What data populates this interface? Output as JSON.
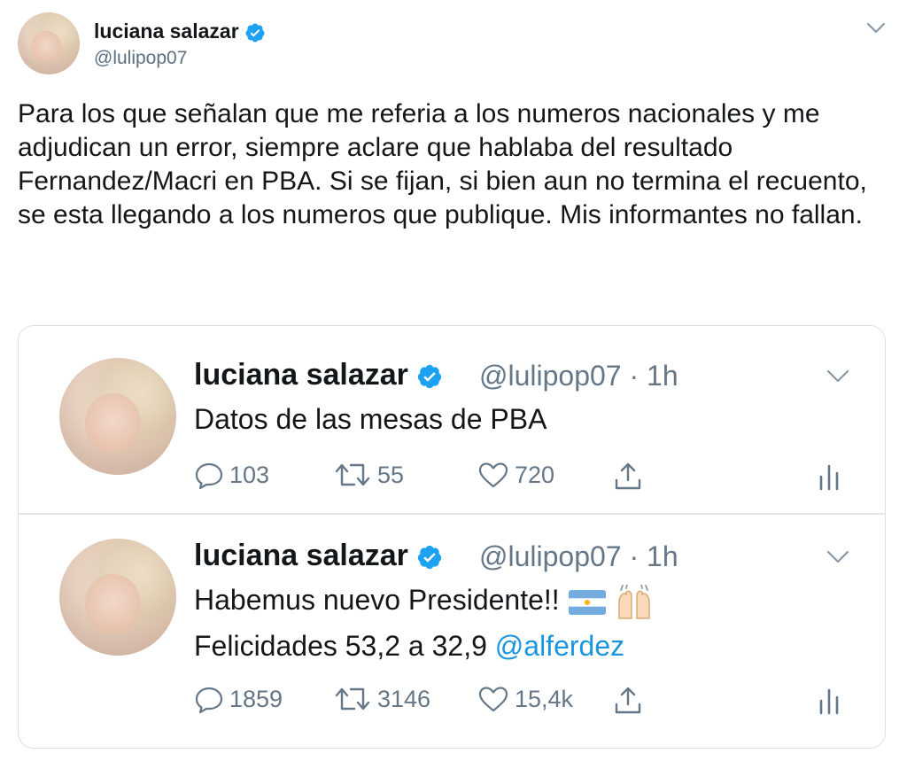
{
  "main_tweet": {
    "author_name": "luciana salazar",
    "author_handle": "@lulipop07",
    "text": "Para los que señalan que me referia a los numeros nacionales y me adjudican un error, siempre aclare que hablaba del resultado Fernandez/Macri en PBA. Si se fijan, si bien aun no termina el recuento, se esta llegando a los numeros que publique. Mis informantes no fallan."
  },
  "quoted_tweets": [
    {
      "author_name": "luciana salazar",
      "author_handle": "@lulipop07",
      "time": "· 1h",
      "text": "Datos de las mesas de PBA",
      "replies": "103",
      "retweets": "55",
      "likes": "720"
    },
    {
      "author_name": "luciana salazar",
      "author_handle": "@lulipop07",
      "time": "· 1h",
      "text_line1": "Habemus nuevo Presidente!!",
      "text_line2": "Felicidades 53,2 a 32,9",
      "mention": "@alferdez",
      "replies": "1859",
      "retweets": "3146",
      "likes": "15,4k"
    }
  ],
  "colors": {
    "verified": "#1da1f2",
    "secondary_text": "#657786",
    "link": "#1b95e0",
    "border": "#d9e1e8"
  },
  "icons": [
    "verified-badge-icon",
    "chevron-down-icon",
    "reply-icon",
    "retweet-icon",
    "like-icon",
    "share-icon",
    "analytics-icon",
    "argentina-flag-emoji",
    "raising-hands-emoji"
  ]
}
